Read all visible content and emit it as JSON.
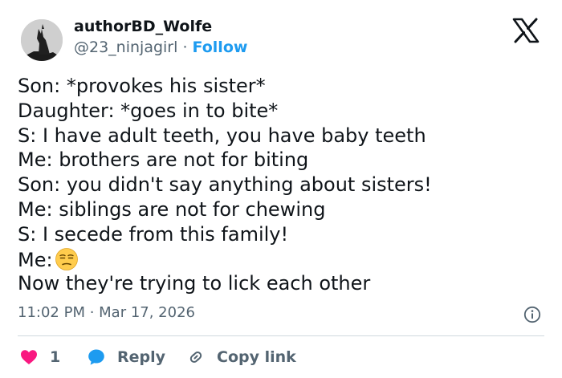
{
  "author": {
    "name": "authorBD_Wolfe",
    "handle": "@23_ninjagirl",
    "separator": " · ",
    "follow_label": "Follow"
  },
  "tweet": {
    "lines": [
      "Son: *provokes his sister*",
      "Daughter: *goes in to bite*",
      "S: I have adult teeth, you have baby teeth",
      "Me: brothers are not for biting",
      "Son: you didn't say anything about sisters!",
      "Me: siblings are not for chewing",
      "S: I secede from this family!",
      "Me:",
      "Now they're trying to lick each other"
    ],
    "emoji": "unamused-face",
    "timestamp": "11:02 PM · Mar 17, 2026"
  },
  "actions": {
    "like_count": "1",
    "reply_label": "Reply",
    "copy_label": "Copy link"
  },
  "colors": {
    "accent": "#1d9bf0",
    "like": "#f91880",
    "muted": "#536471",
    "text": "#0f1419",
    "divider": "#cfd9de"
  },
  "icons": [
    "avatar-wolf",
    "x-logo-icon",
    "info-icon",
    "heart-icon",
    "reply-bubble-icon",
    "link-icon"
  ]
}
